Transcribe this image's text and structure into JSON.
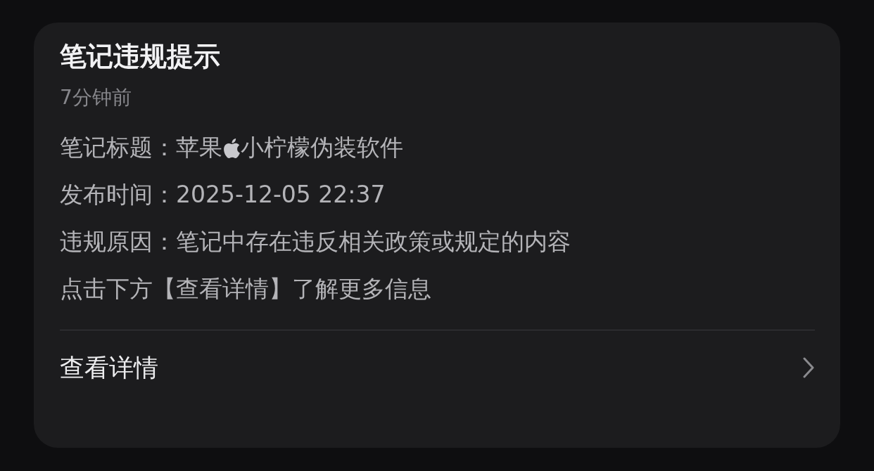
{
  "notice": {
    "title": "笔记违规提示",
    "time": "7分钟前",
    "lines": [
      {
        "kind": "icon",
        "text": "笔记标题：苹果",
        "text_after": "小柠檬伪装软件"
      },
      {
        "kind": "plain",
        "text": "发布时间：2025-12-05 22:37"
      },
      {
        "kind": "plain",
        "text": "违规原因：笔记中存在违反相关政策或规定的内容"
      },
      {
        "kind": "plain",
        "text": "点击下方【查看详情】了解更多信息"
      }
    ],
    "action": {
      "label": "查看详情"
    }
  }
}
